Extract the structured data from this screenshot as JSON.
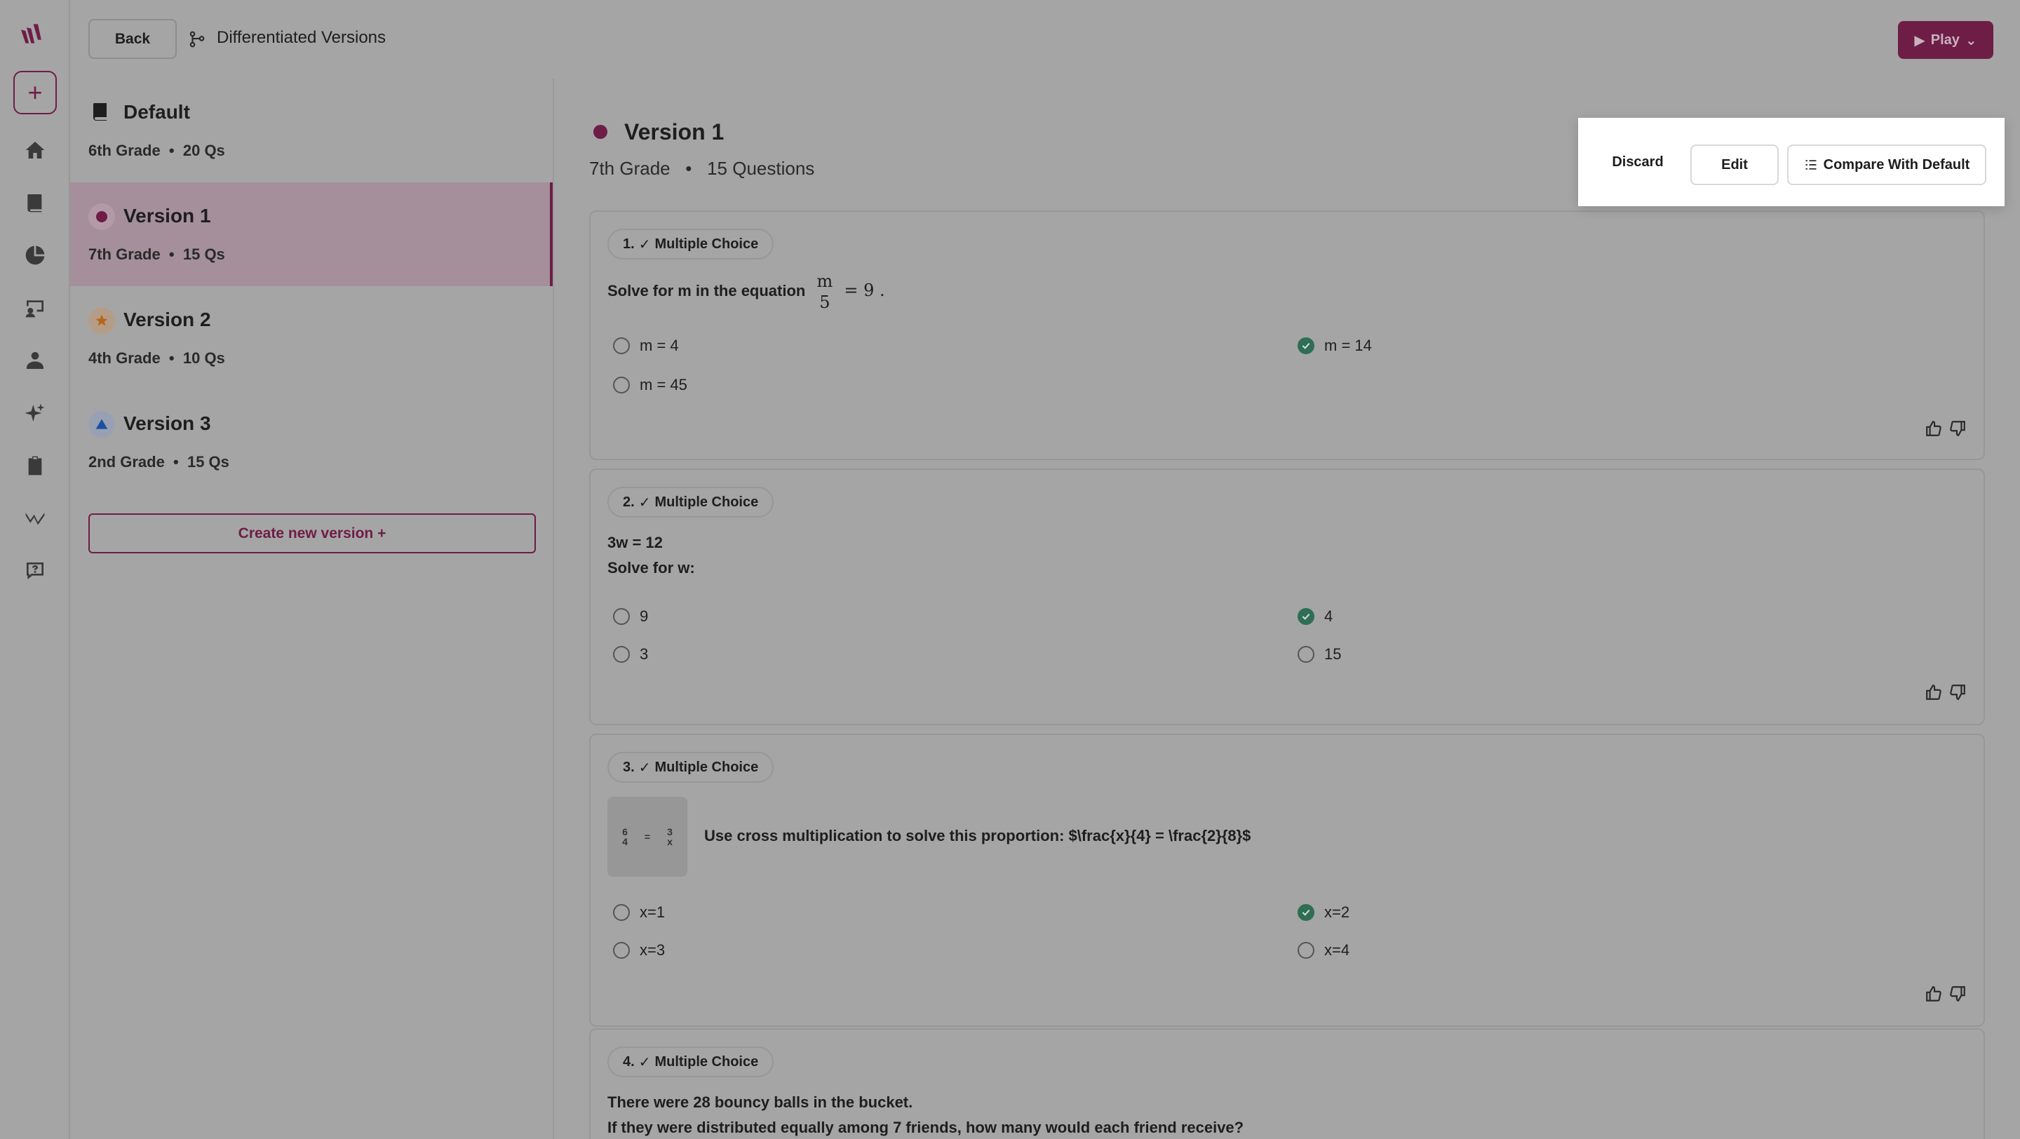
{
  "header": {
    "back_label": "Back",
    "title": "Differentiated Versions",
    "play_label": "Play"
  },
  "rail": {
    "icons": [
      "logo-icon",
      "add-icon",
      "home-icon",
      "library-icon",
      "reports-icon",
      "classes-icon",
      "students-icon",
      "ai-sparkle-icon",
      "assignments-icon",
      "analytics-icon",
      "help-icon"
    ]
  },
  "versions": [
    {
      "name": "Default",
      "grade": "6th Grade",
      "count": "20 Qs"
    },
    {
      "name": "Version 1",
      "grade": "7th Grade",
      "count": "15 Qs"
    },
    {
      "name": "Version 2",
      "grade": "4th Grade",
      "count": "10 Qs"
    },
    {
      "name": "Version 3",
      "grade": "2nd Grade",
      "count": "15 Qs"
    }
  ],
  "create_label": "Create new version +",
  "main": {
    "title": "Version 1",
    "grade": "7th Grade",
    "questions_count": "15 Questions",
    "actions": {
      "discard": "Discard",
      "edit": "Edit",
      "compare": "Compare With Default"
    }
  },
  "questions": [
    {
      "number": "1.",
      "type": "Multiple Choice",
      "text_prefix": "Solve for m in the equation",
      "frac_num": "m",
      "frac_den": "5",
      "text_suffix": "= 9 .",
      "options": [
        "m = 4",
        "m = 14",
        "m = 45"
      ]
    },
    {
      "number": "2.",
      "type": "Multiple Choice",
      "line1": "3w = 12",
      "line2": "Solve for w:",
      "options": [
        "9",
        "4",
        "3",
        "15"
      ]
    },
    {
      "number": "3.",
      "type": "Multiple Choice",
      "text": "Use cross multiplication to solve this proportion: $\\frac{x}{4} = \\frac{2}{8}$",
      "image_left_num": "6",
      "image_left_den": "4",
      "image_eq": "=",
      "image_right_num": "3",
      "image_right_den": "x",
      "options": [
        "x=1",
        "x=2",
        "x=3",
        "x=4"
      ]
    },
    {
      "number": "4.",
      "type": "Multiple Choice",
      "line1": "There were 28 bouncy balls in the bucket.",
      "line2": "If they were distributed equally among 7 friends, how many would each friend receive?"
    }
  ],
  "colors": {
    "brand": "#6e1d46",
    "correct": "#2f6e55",
    "version2_star": "#b8651a",
    "version3_triangle": "#1f4fa0"
  }
}
